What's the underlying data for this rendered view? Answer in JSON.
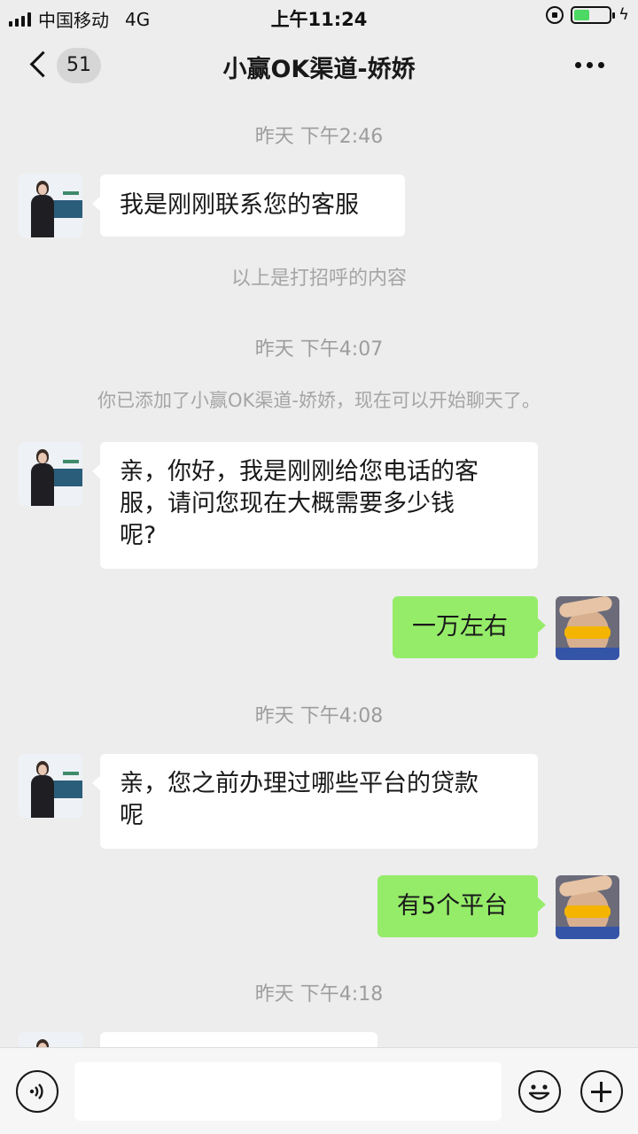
{
  "status_bar": {
    "carrier": "中国移动",
    "network": "4G",
    "time": "上午11:24",
    "battery_level": 0.45
  },
  "nav": {
    "unread_count": "51",
    "title": "小赢OK渠道-娇娇"
  },
  "messages": {
    "time_1": "昨天 下午2:46",
    "msg_1": "我是刚刚联系您的客服",
    "note_1": "以上是打招呼的内容",
    "time_2": "昨天 下午4:07",
    "note_2": "你已添加了小赢OK渠道-娇娇，现在可以开始聊天了。",
    "msg_2_line1": "亲，你好，我是刚刚给您电话的客",
    "msg_2_line2": "服，请问您现在大概需要多少钱",
    "msg_2_line3": "呢?",
    "reply_1": "一万左右",
    "time_3": "昨天 下午4:08",
    "msg_3_line1": "亲，您之前办理过哪些平台的贷款",
    "msg_3_line2": "呢",
    "reply_2": "有5个平台",
    "time_4": "昨天 下午4:18"
  },
  "icons": {
    "back": "chevron-left-icon",
    "more": "more-dots-icon",
    "voice": "voice-icon",
    "emoji": "emoji-icon",
    "plus": "plus-icon"
  },
  "colors": {
    "background": "#ededed",
    "incoming_bubble": "#ffffff",
    "outgoing_bubble": "#95ec69",
    "battery_fill": "#4cd964"
  }
}
